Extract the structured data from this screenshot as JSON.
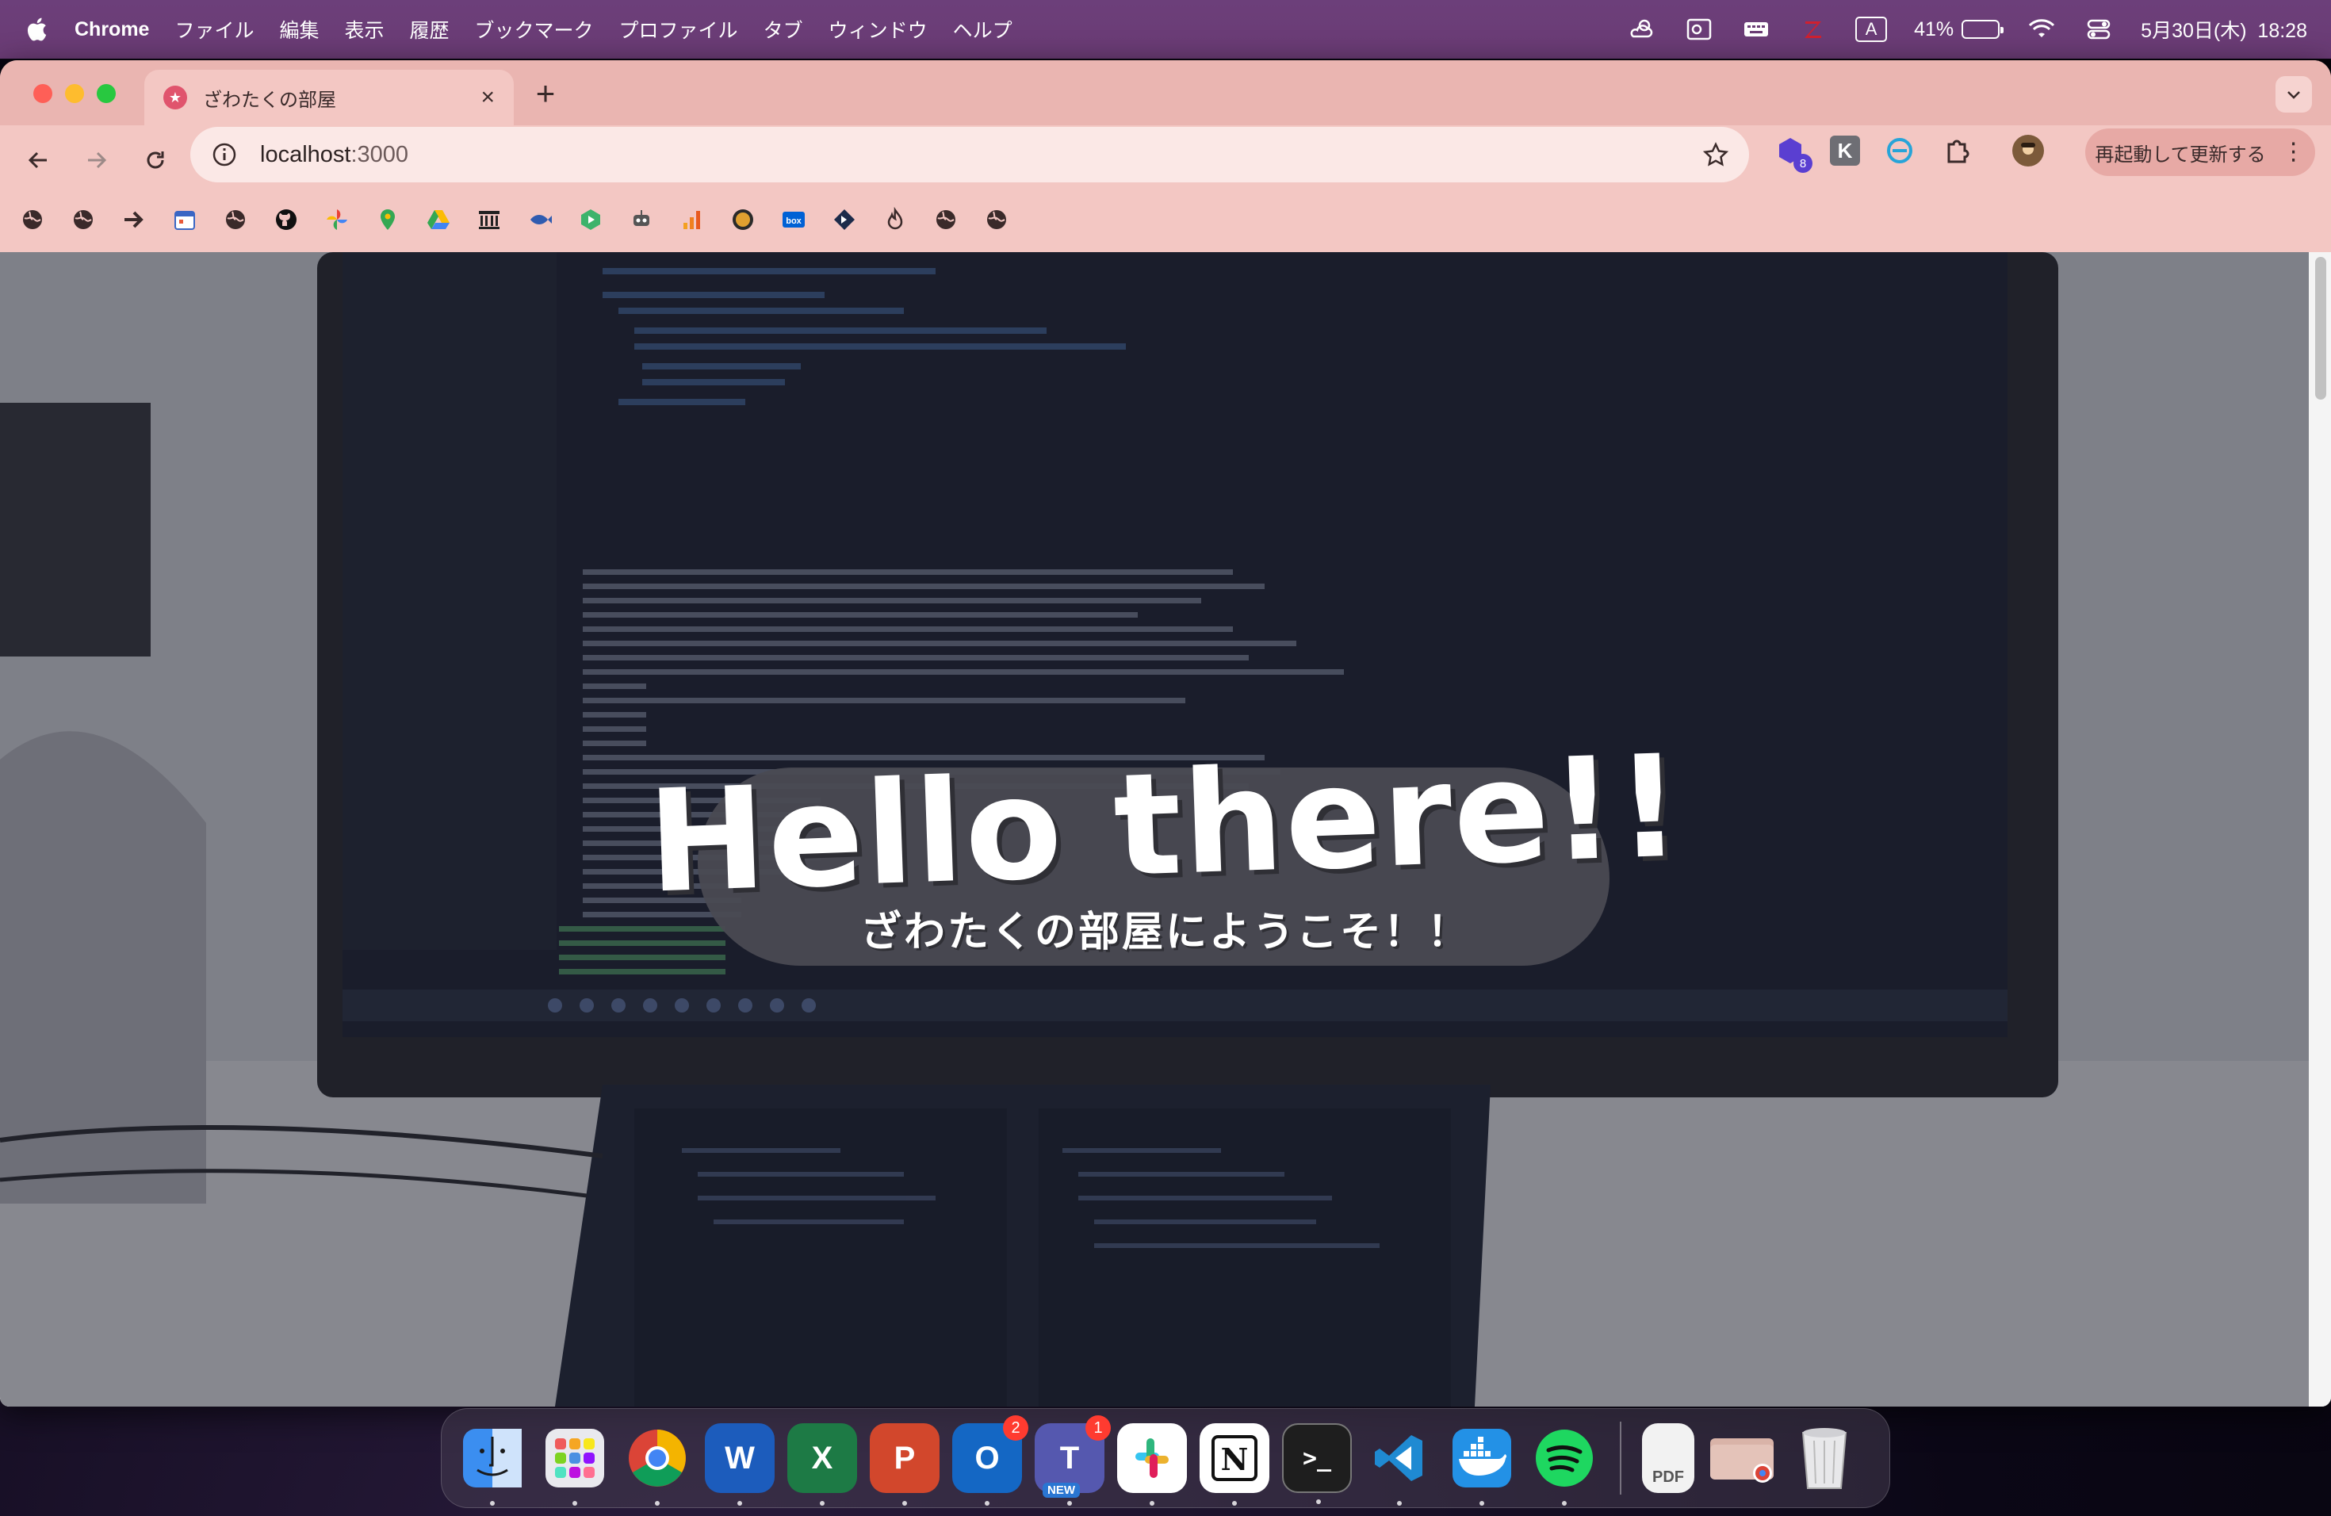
{
  "menubar": {
    "app_name": "Chrome",
    "items": [
      "ファイル",
      "編集",
      "表示",
      "履歴",
      "ブックマーク",
      "プロファイル",
      "タブ",
      "ウィンドウ",
      "ヘルプ"
    ],
    "input_mode": "A",
    "battery_percent": "41%",
    "battery_level": 0.41,
    "datetime": "5月30日(木)  18:28"
  },
  "browser": {
    "tab_title": "ざわたくの部屋",
    "url_host": "localhost",
    "url_port": ":3000",
    "extension_badge": "8",
    "extension_k_label": "K",
    "update_button_label": "再起動して更新する",
    "bookmark_icons": [
      "globe-icon",
      "globe-icon",
      "arrow-right-icon",
      "calendar-icon",
      "globe-icon",
      "github-icon",
      "pinwheel-icon",
      "maps-pin-icon",
      "drive-icon",
      "bank-icon",
      "fish-icon",
      "play-hexagon-icon",
      "robot-icon",
      "bar-chart-icon",
      "coin-icon",
      "box-icon",
      "diamond-arrow-icon",
      "flame-icon",
      "globe-icon",
      "globe-icon"
    ],
    "box_label": "box"
  },
  "page": {
    "hero_title": "Hello there!!",
    "hero_subtitle": "ざわたくの部屋にようこそ！！"
  },
  "dock": {
    "apps": [
      {
        "name": "finder",
        "label": "",
        "color": "#3b8ef0"
      },
      {
        "name": "launchpad",
        "label": "",
        "color": "#e9e9ee"
      },
      {
        "name": "chrome",
        "label": "",
        "color": "#ffffff"
      },
      {
        "name": "word",
        "label": "W",
        "color": "#1c5cbc"
      },
      {
        "name": "excel",
        "label": "X",
        "color": "#1d7a45"
      },
      {
        "name": "powerpoint",
        "label": "P",
        "color": "#d2472c"
      },
      {
        "name": "outlook",
        "label": "O",
        "color": "#1467c4",
        "badge": "2"
      },
      {
        "name": "teams",
        "label": "T",
        "color": "#5558af",
        "badge": "1",
        "tag": "NEW"
      },
      {
        "name": "slack",
        "label": "#",
        "color": "#ffffff"
      },
      {
        "name": "notion",
        "label": "N",
        "color": "#ffffff"
      },
      {
        "name": "terminal",
        "label": ">_",
        "color": "#1e1e1e"
      },
      {
        "name": "vscode",
        "label": "",
        "color": "#1f8ad2"
      },
      {
        "name": "docker",
        "label": "",
        "color": "#2391e6"
      },
      {
        "name": "spotify",
        "label": "",
        "color": "#1ed760"
      }
    ],
    "pdf_label": "PDF"
  }
}
